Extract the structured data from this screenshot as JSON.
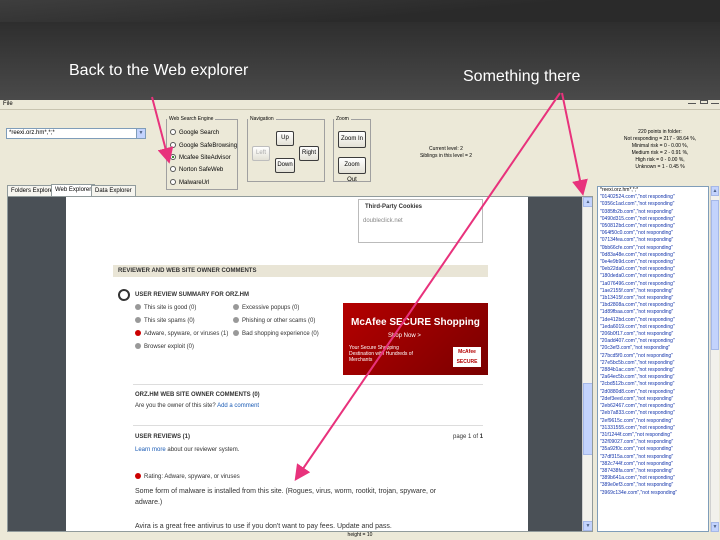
{
  "captions": {
    "left": "Back to the Web explorer",
    "right": "Something there"
  },
  "menu": {
    "file": "File"
  },
  "url_combo": {
    "value": "*reexi.orz.hm*,*;*"
  },
  "search_engine": {
    "legend": "Web Search Engine",
    "options": [
      "Google Search",
      "Google SafeBrowsing",
      "Mcafee SiteAdvisor",
      "Norton SafeWeb",
      "MalwareUrl"
    ],
    "selected_index": 2
  },
  "navigation": {
    "legend": "Navigation",
    "up": "Up",
    "left": "Left",
    "right": "Right",
    "down": "Down"
  },
  "zoom": {
    "legend": "Zoom",
    "zoom_in": "Zoom In",
    "zoom_out": "Zoom Out"
  },
  "level_info": {
    "line1": "Current level: 2",
    "line2": "Siblings in this level = 2"
  },
  "folder_stats": {
    "line1": "220 points in folder:",
    "line2": "Not responding = 217 - 98.64 %,",
    "line3": "Minimal risk = 0 - 0.00 %,",
    "line4": "Medium risk = 2 - 0.91 %,",
    "line5": "High risk = 0 - 0.00 %,",
    "line6": "Unknown = 1 - 0.45 %"
  },
  "tabs": [
    "Folders Explorer",
    "Web Explorer",
    "Data Explorer"
  ],
  "webpage": {
    "cookies_title": "Third-Party Cookies",
    "cookies_item": "doubleclick.net",
    "section_title": "REVIEWER AND WEB SITE OWNER COMMENTS",
    "summary_title": "USER REVIEW SUMMARY FOR ORZ.HM",
    "summary_items": [
      "This site is good (0)",
      "Excessive popups (0)",
      "This site spams (0)",
      "Phishing or other scams (0)",
      "Adware, spyware, or viruses (1)",
      "Bad shopping experience (0)",
      "Browser exploit (0)"
    ],
    "ad": {
      "title": "McAfee SECURE Shopping",
      "cta": "Shop Now >",
      "text": "Your Secure Shopping Destination with Hundreds of Merchants",
      "seal": "McAfee SECURE"
    },
    "owner_title": "ORZ.HM WEB SITE OWNER COMMENTS (0)",
    "owner_q": "Are you the owner of this site?",
    "owner_link": "Add a comment",
    "reviews_title": "USER REVIEWS (1)",
    "page_prefix": "page 1 of",
    "page_total": "1",
    "learn_more": "Learn more",
    "learn_more_rest": "about our reviewer system.",
    "rating_label": "Rating: Adware, spyware, or viruses",
    "review_text_1": "Some form of malware is installed from this site. (Rogues, virus, worm, rootkit, trojan, spyware, or",
    "review_text_2": "adware.)",
    "review_text_3": "Avira is a great free antivirus to use if you don't want to pay fees. Update and pass."
  },
  "side_list": {
    "items": [
      "*reexi.orz.hm*,*;*",
      "\"01402524.com\",\"not responding\"",
      "\"0356c1ad.com\",\"not responding\"",
      "\"0385fb2b.com\",\"not responding\"",
      "\"0490d315.com\",\"not responding\"",
      "\"050812bd.com\",\"not responding\"",
      "\"064f50c0.com\",\"not responding\"",
      "\"07134fea.com\",\"not responding\"",
      "\"0bb66cfe.com\",\"not responding\"",
      "\"0d83a48e.com\",\"not responding\"",
      "\"0e4e9b9d.com\",\"not responding\"",
      "\"0eb22da0.com\",\"not responding\"",
      "\"180deda0.com\",\"not responding\"",
      "\"1a076496.com\",\"not responding\"",
      "\"1ae2155f.com\",\"not responding\"",
      "\"1b13415f.com\",\"not responding\"",
      "\"1bd2808a.com\",\"not responding\"",
      "\"1d89fbaa.com\",\"not responding\"",
      "\"1de412bd.com\",\"not responding\"",
      "\"1eda6019.com\",\"not responding\"",
      "\"206b0f17.com\",\"not responding\"",
      "\"20add407.com\",\"not responding\"",
      "\"20c3ef3.com\",\"not responding\"",
      "\"27bcd5f0.com\",\"not responding\"",
      "\"27e5bc5b.com\",\"not responding\"",
      "\"2884b1ac.com\",\"not responding\"",
      "\"2a64ec5b.com\",\"not responding\"",
      "\"2cbd512b.com\",\"not responding\"",
      "\"2d0880d8.com\",\"not responding\"",
      "\"2def3eed.com\",\"not responding\"",
      "\"2eb62467.com\",\"not responding\"",
      "\"2eb7a833.com\",\"not responding\"",
      "\"2ef9615c.com\",\"not responding\"",
      "\"31331555.com\",\"not responding\"",
      "\"31f1244f.com\",\"not responding\"",
      "\"32f09027.com\",\"not responding\"",
      "\"35a92f0c.com\",\"not responding\"",
      "\"37df315a.com\",\"not responding\"",
      "\"382c744f.com\",\"not responding\"",
      "\"387438fa.com\",\"not responding\"",
      "\"389b641a.com\",\"not responding\"",
      "\"389e0ef3.com\",\"not responding\"",
      "\"3969c134e.com\",\"not responding\""
    ]
  },
  "bottom_status": "height = 10",
  "colors": {
    "arrow": "#e8327c",
    "link": "#1a5bb5",
    "ad_red": "#b40000"
  }
}
